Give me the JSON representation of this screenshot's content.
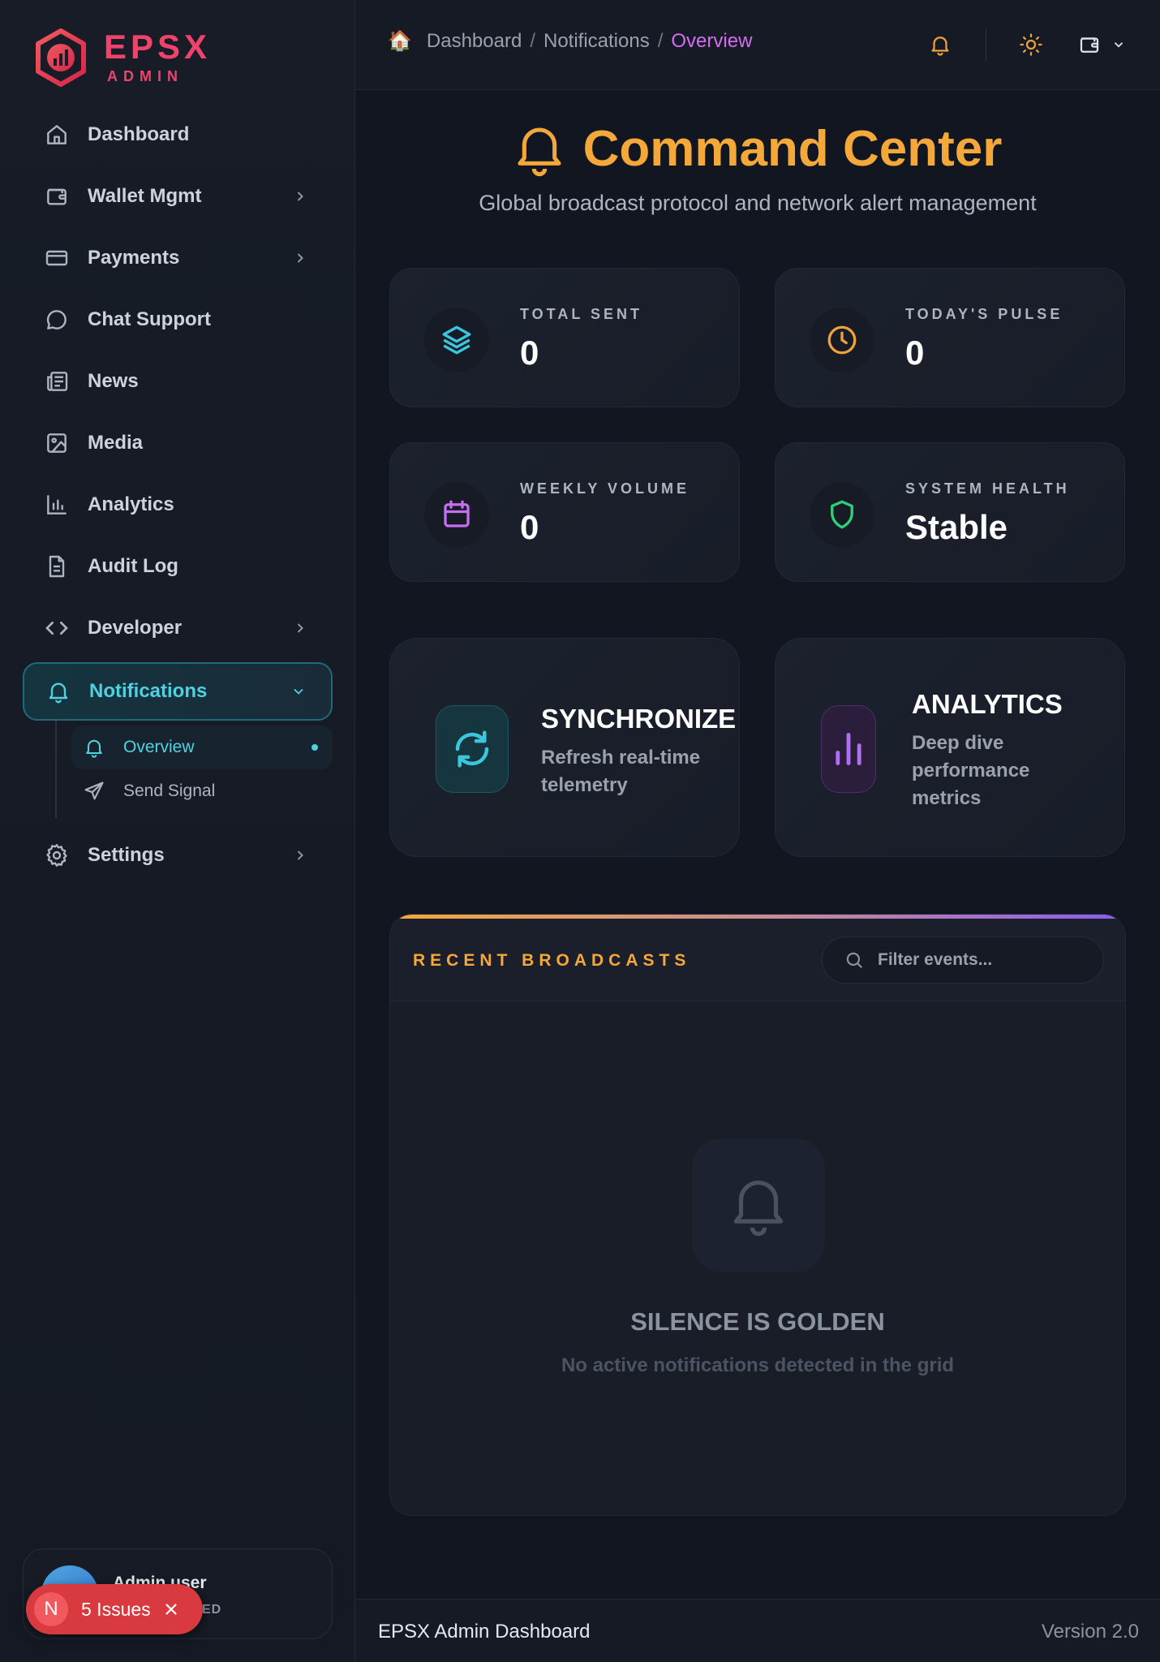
{
  "brand": {
    "title": "EPSX",
    "subtitle": "ADMIN"
  },
  "sidebar": {
    "items": [
      {
        "label": "Dashboard",
        "icon": "home-icon"
      },
      {
        "label": "Wallet Mgmt",
        "icon": "wallet-icon"
      },
      {
        "label": "Payments",
        "icon": "credit-card-icon"
      },
      {
        "label": "Chat Support",
        "icon": "chat-bubble-icon"
      },
      {
        "label": "News",
        "icon": "newspaper-icon"
      },
      {
        "label": "Media",
        "icon": "image-icon"
      },
      {
        "label": "Analytics",
        "icon": "bar-chart-icon"
      },
      {
        "label": "Audit Log",
        "icon": "document-icon"
      },
      {
        "label": "Developer",
        "icon": "code-icon"
      },
      {
        "label": "Notifications",
        "icon": "bell-icon"
      },
      {
        "label": "Settings",
        "icon": "gear-icon"
      }
    ],
    "sub_items": [
      {
        "label": "Overview",
        "icon": "bell-icon"
      },
      {
        "label": "Send Signal",
        "icon": "send-icon"
      }
    ]
  },
  "user": {
    "name": "Admin user",
    "role": "ED"
  },
  "issues": {
    "badge": "N",
    "label": "5 Issues"
  },
  "breadcrumb": {
    "home_icon": "🏠",
    "items": [
      "Dashboard",
      "Notifications",
      "Overview"
    ],
    "separator": "/"
  },
  "hero": {
    "title": "Command Center",
    "subtitle": "Global broadcast protocol and network alert management"
  },
  "stats": [
    {
      "label": "TOTAL SENT",
      "value": "0",
      "icon": "layers-icon",
      "color": "#3cc6dc"
    },
    {
      "label": "TODAY'S PULSE",
      "value": "0",
      "icon": "clock-icon",
      "color": "#f0a23a"
    },
    {
      "label": "WEEKLY VOLUME",
      "value": "0",
      "icon": "calendar-icon",
      "color": "#c66ef0"
    },
    {
      "label": "SYSTEM HEALTH",
      "value": "Stable",
      "icon": "shield-icon",
      "color": "#2ed07a"
    }
  ],
  "actions": [
    {
      "title": "SYNCHRONIZE",
      "desc_line1": "Refresh real-time",
      "desc_line2": "telemetry",
      "icon": "refresh-icon"
    },
    {
      "title": "ANALYTICS",
      "desc_line1": "Deep dive",
      "desc_line2": "performance",
      "desc_line3": "metrics",
      "icon": "bar-chart-icon"
    }
  ],
  "broadcasts": {
    "title": "RECENT BROADCASTS",
    "filter_placeholder": "Filter events...",
    "empty_title": "SILENCE IS GOLDEN",
    "empty_subtitle": "No active notifications detected in the grid"
  },
  "footer": {
    "left": "EPSX Admin Dashboard",
    "right": "Version 2.0"
  }
}
